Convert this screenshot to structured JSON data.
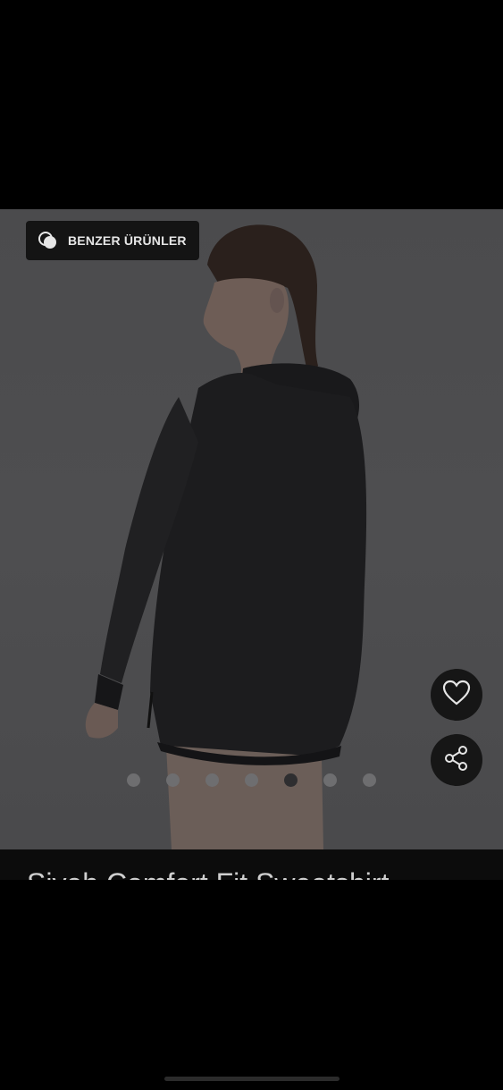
{
  "product": {
    "title": "Siyah Comfort Fit Sweatshirt"
  },
  "gallery": {
    "similar_button_label": "BENZER ÜRÜNLER",
    "dot_count": 7,
    "active_index": 4
  },
  "icons": {
    "similar": "overlapping-circles-icon",
    "favorite": "heart-icon",
    "share": "share-icon"
  },
  "colors": {
    "overlay_background": "#4c4c4e",
    "button_background": "#161616",
    "active_dot": "#2e2e30",
    "inactive_dot": "#6e6e70"
  }
}
